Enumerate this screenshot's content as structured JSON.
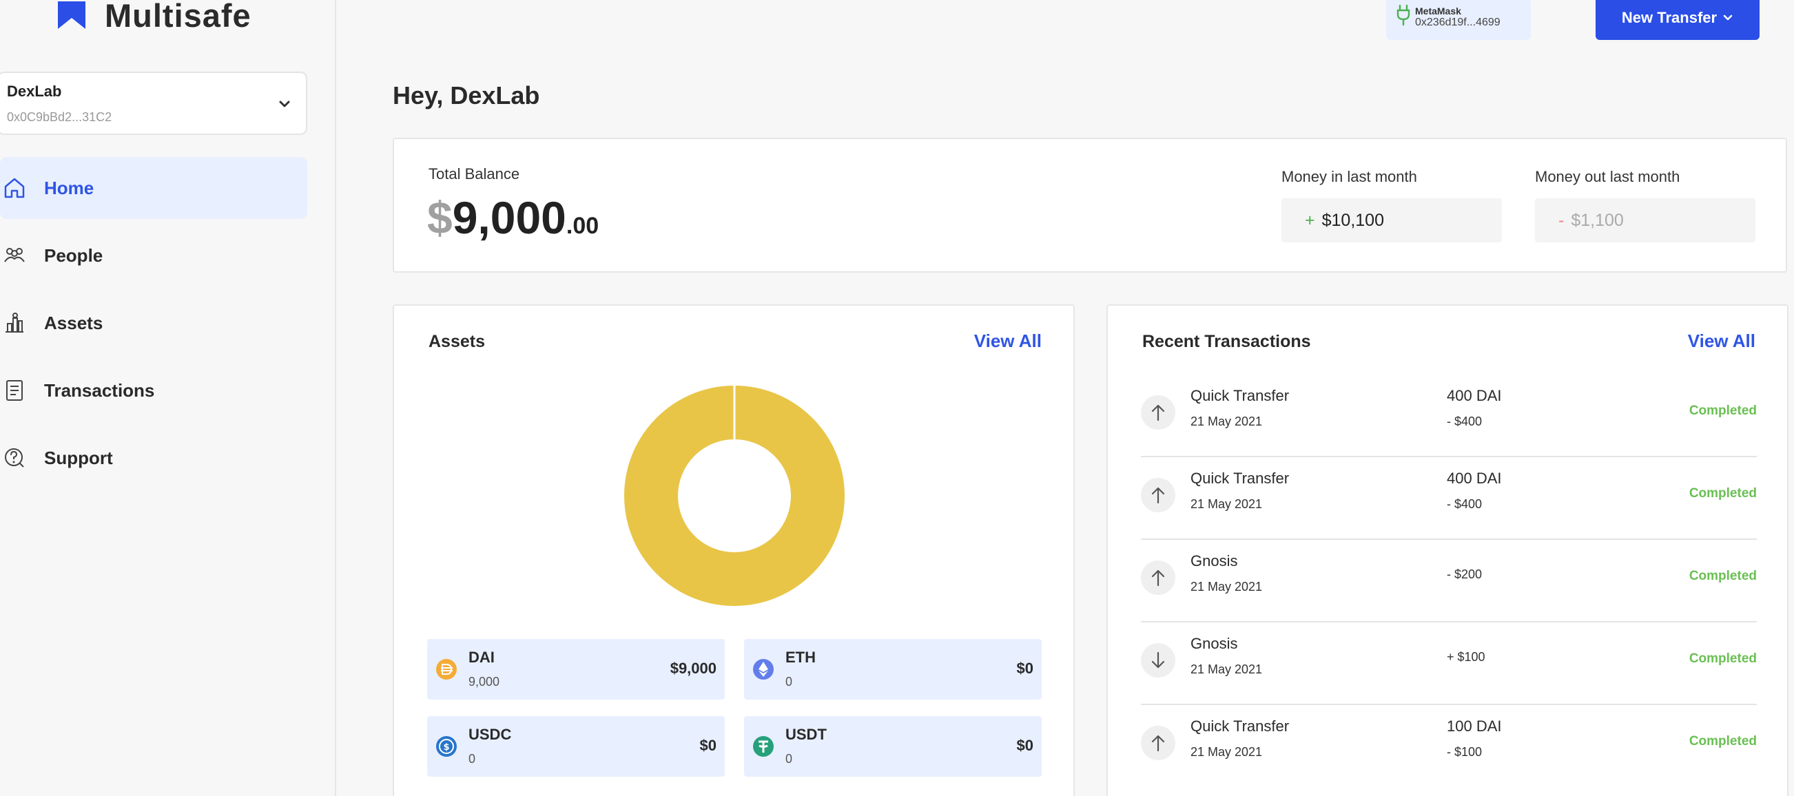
{
  "brand": {
    "name": "Multisafe"
  },
  "safe": {
    "name": "DexLab",
    "address": "0x0C9bBd2...31C2"
  },
  "nav": [
    {
      "label": "Home",
      "icon": "home-icon",
      "active": true
    },
    {
      "label": "People",
      "icon": "people-icon",
      "active": false
    },
    {
      "label": "Assets",
      "icon": "assets-icon",
      "active": false
    },
    {
      "label": "Transactions",
      "icon": "transactions-icon",
      "active": false
    },
    {
      "label": "Support",
      "icon": "support-icon",
      "active": false
    }
  ],
  "wallet": {
    "name": "MetaMask",
    "address": "0x236d19f...4699"
  },
  "header": {
    "new_transfer_label": "New Transfer",
    "greeting": "Hey, DexLab"
  },
  "balance": {
    "label": "Total Balance",
    "currency": "$",
    "integer": "9,000",
    "decimal": ".00",
    "money_in_label": "Money in last month",
    "money_in_sign": "+",
    "money_in_value": "$10,100",
    "money_out_label": "Money out last month",
    "money_out_sign": "-",
    "money_out_value": "$1,100"
  },
  "assets": {
    "title": "Assets",
    "view_all": "View All",
    "items": [
      {
        "symbol": "DAI",
        "amount": "9,000",
        "value": "$9,000",
        "icon": "dai-icon"
      },
      {
        "symbol": "ETH",
        "amount": "0",
        "value": "$0",
        "icon": "eth-icon"
      },
      {
        "symbol": "USDC",
        "amount": "0",
        "value": "$0",
        "icon": "usdc-icon"
      },
      {
        "symbol": "USDT",
        "amount": "0",
        "value": "$0",
        "icon": "usdt-icon"
      }
    ]
  },
  "chart_data": {
    "type": "pie",
    "donut": true,
    "categories": [
      "DAI",
      "ETH",
      "USDC",
      "USDT"
    ],
    "values": [
      9000,
      0,
      0,
      0
    ],
    "colors": {
      "DAI": "#e8c547"
    }
  },
  "transactions": {
    "title": "Recent Transactions",
    "view_all": "View All",
    "items": [
      {
        "name": "Quick Transfer",
        "date": "21 May 2021",
        "token": "400 DAI",
        "usd": "- $400",
        "status": "Completed",
        "direction": "out"
      },
      {
        "name": "Quick Transfer",
        "date": "21 May 2021",
        "token": "400 DAI",
        "usd": "- $400",
        "status": "Completed",
        "direction": "out"
      },
      {
        "name": "Gnosis",
        "date": "21 May 2021",
        "token": "",
        "usd": "- $200",
        "status": "Completed",
        "direction": "out"
      },
      {
        "name": "Gnosis",
        "date": "21 May 2021",
        "token": "",
        "usd": "+ $100",
        "status": "Completed",
        "direction": "in"
      },
      {
        "name": "Quick Transfer",
        "date": "21 May 2021",
        "token": "100 DAI",
        "usd": "- $100",
        "status": "Completed",
        "direction": "out"
      }
    ]
  },
  "colors": {
    "accent": "#2a4ee6",
    "active_bg": "#e8efff",
    "completed": "#6abf53",
    "donut": "#e8c547"
  }
}
